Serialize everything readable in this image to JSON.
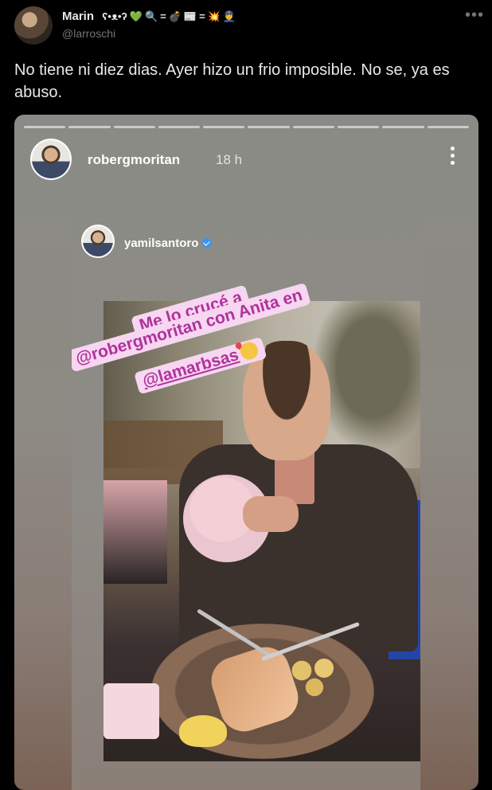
{
  "tweet": {
    "display_name": "Marin",
    "name_emojis": [
      "ʕ•ᴥ•ʔ",
      "💚",
      "🔍",
      "=",
      "💣",
      "📰",
      "=",
      "💥",
      "👮"
    ],
    "handle": "@larroschi",
    "more_label": "•••",
    "text": "No tiene ni diez dias. Ayer hizo un frio imposible. No se, ya es abuso."
  },
  "story": {
    "username": "robergmoritan",
    "time": "18 h",
    "progress_segments": 10,
    "reshare": {
      "username": "yamilsantoro",
      "verified": true,
      "caption_lines": [
        "Me lo crucé a",
        "@robergmoritan con Anita en",
        "@lamarbsas"
      ],
      "caption_emoji": "smiling-face-with-hearts"
    }
  },
  "colors": {
    "background": "#000000",
    "text_primary": "#e7e9ea",
    "text_secondary": "#71767b",
    "caption_bg": "#f7d6f1",
    "caption_text": "#b0329b",
    "verified": "#3897f0"
  }
}
